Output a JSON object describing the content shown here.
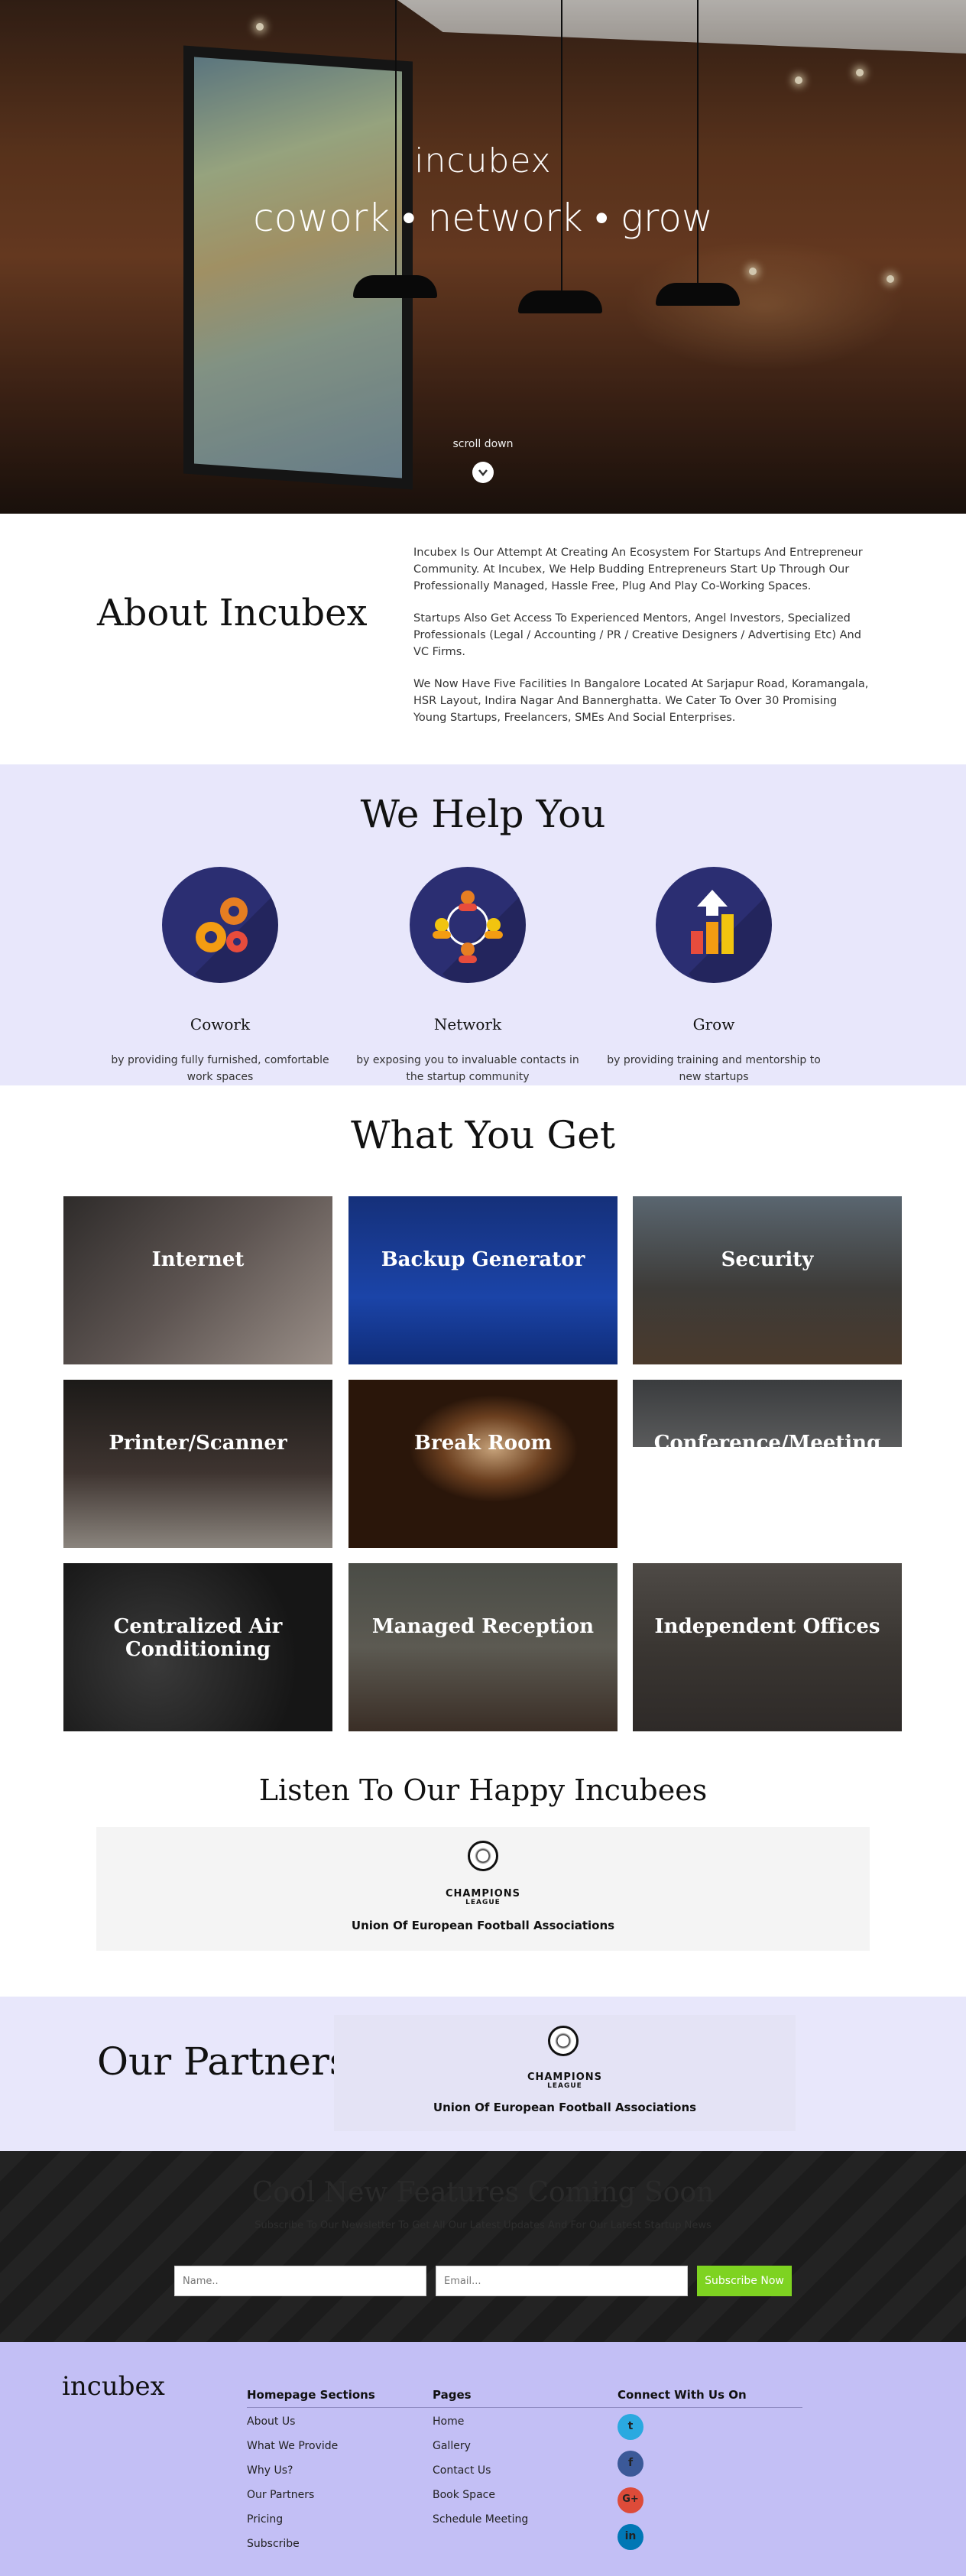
{
  "hero": {
    "title": "incubex",
    "tagline": "cowork • network • grow",
    "scroll_label": "scroll down",
    "scroll_icon": "chevron-down-icon"
  },
  "about": {
    "heading": "About Incubex",
    "paragraphs": [
      "Incubex Is Our Attempt At Creating An Ecosystem For Startups And Entrepreneur Community.  At Incubex, We Help Budding Entrepreneurs Start Up Through Our Professionally Managed, Hassle Free, Plug And Play Co-Working Spaces.",
      "Startups Also Get Access To Experienced Mentors, Angel Investors, Specialized Professionals (Legal / Accounting / PR / Creative Designers / Advertising Etc) And VC Firms.",
      "We Now Have Five Facilities In Bangalore Located At Sarjapur Road, Koramangala, HSR Layout, Indira Nagar And Bannerghatta.  We Cater To Over 30 Promising Young Startups, Freelancers, SMEs And Social Enterprises."
    ]
  },
  "help": {
    "heading": "We Help You",
    "items": [
      {
        "title": "Cowork",
        "desc": "by providing fully furnished, comfortable work spaces",
        "icon": "gears-icon"
      },
      {
        "title": "Network",
        "desc": "by exposing you to invaluable contacts in the startup community",
        "icon": "network-people-icon"
      },
      {
        "title": "Grow",
        "desc": "by providing training and mentorship to new startups",
        "icon": "growth-chart-icon"
      }
    ]
  },
  "get": {
    "heading": "What You Get",
    "tiles": [
      "Internet",
      "Backup Generator",
      "Security",
      "Printer/Scanner",
      "Break Room",
      "Conference/Meeting Rooms",
      "Centralized Air Conditioning",
      "Managed Reception",
      "Independent Offices"
    ]
  },
  "testimonials": {
    "heading": "Listen To Our Happy Incubees",
    "logo_text": "CHAMPIONS",
    "logo_sub": "LEAGUE",
    "name": "Union Of European Football Associations"
  },
  "partners": {
    "heading": "Our Partners",
    "logo_text": "CHAMPIONS",
    "logo_sub": "LEAGUE",
    "name": "Union Of European Football Associations"
  },
  "subscribe": {
    "heading": "Cool New Features Coming Soon",
    "subtext": "Subscribe To Our Newsletter To Get All Our Latest Updates And For Our Latest Startup News",
    "name_placeholder": "Name..",
    "email_placeholder": "Email...",
    "button": "Subscribe Now",
    "button_color": "#7ed321"
  },
  "footer": {
    "brand": "incubex",
    "homepage_heading": "Homepage Sections",
    "homepage_links": [
      "About Us",
      "What We Provide",
      "Why Us?",
      "Our Partners",
      "Pricing",
      "Subscribe"
    ],
    "pages_heading": "Pages",
    "pages_links": [
      "Home",
      "Gallery",
      "Contact Us",
      "Book Space",
      "Schedule Meeting"
    ],
    "connect_heading": "Connect With Us On",
    "social": [
      {
        "name": "twitter-icon",
        "glyph": "t",
        "color": "#2aa9e0"
      },
      {
        "name": "facebook-icon",
        "glyph": "f",
        "color": "#3b5998"
      },
      {
        "name": "google-plus-icon",
        "glyph": "G+",
        "color": "#dd4b39"
      },
      {
        "name": "linkedin-icon",
        "glyph": "in",
        "color": "#0077b5"
      }
    ]
  }
}
